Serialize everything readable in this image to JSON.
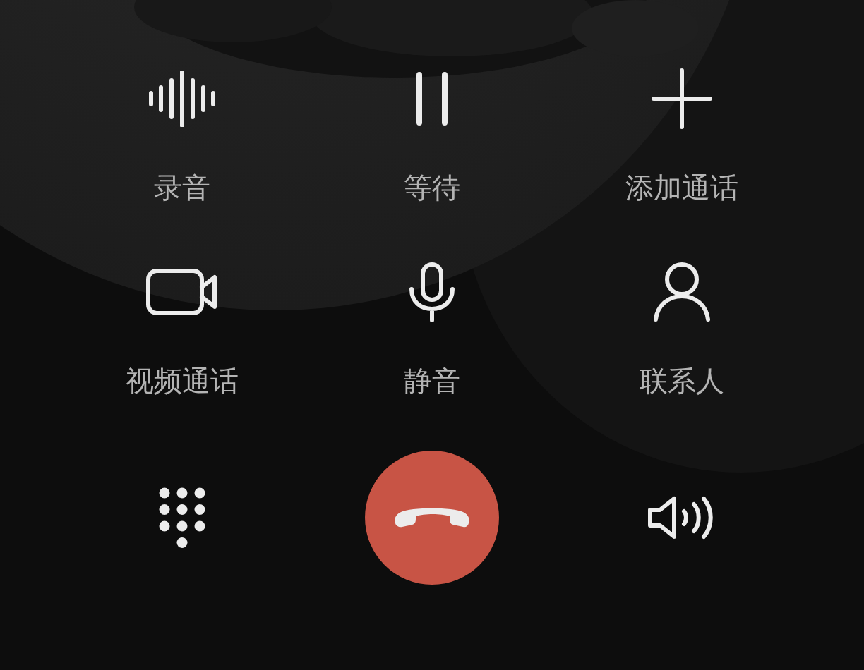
{
  "actions": [
    {
      "label": "录音"
    },
    {
      "label": "等待"
    },
    {
      "label": "添加通话"
    },
    {
      "label": "视频通话"
    },
    {
      "label": "静音"
    },
    {
      "label": "联系人"
    }
  ]
}
